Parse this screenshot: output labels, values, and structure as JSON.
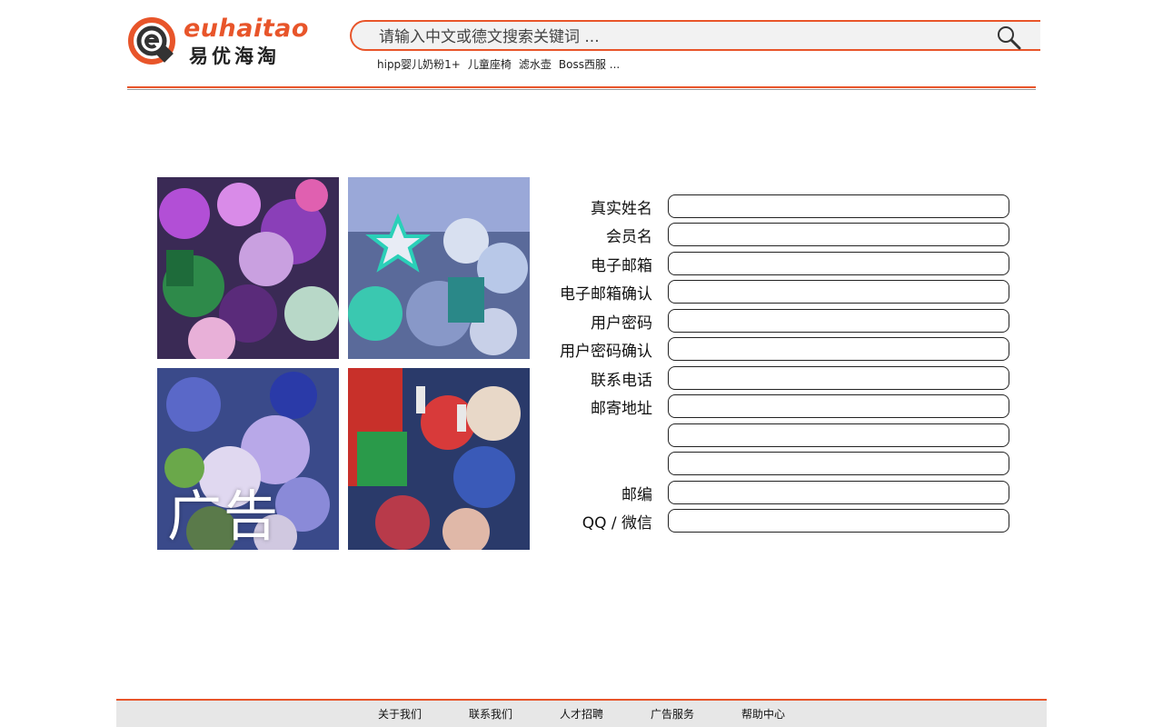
{
  "brand": {
    "name_en": "euhaitao",
    "name_cn": "易优海淘",
    "accent_color": "#e8552a"
  },
  "search": {
    "placeholder": "请输入中文或德文搜索关键词 ...",
    "icon": "search-icon",
    "hot_keywords": [
      "hipp婴儿奶粉1+",
      "儿童座椅",
      "滤水壶",
      "Boss西服 ..."
    ]
  },
  "ad": {
    "label": "广告"
  },
  "form": {
    "fields": [
      {
        "label": "真实姓名",
        "value": ""
      },
      {
        "label": "会员名",
        "value": ""
      },
      {
        "label": "电子邮箱",
        "value": ""
      },
      {
        "label": "电子邮箱确认",
        "value": ""
      },
      {
        "label": "用户密码",
        "value": ""
      },
      {
        "label": "用户密码确认",
        "value": ""
      },
      {
        "label": "联系电话",
        "value": ""
      },
      {
        "label": "邮寄地址",
        "value": ""
      },
      {
        "label": "",
        "value": ""
      },
      {
        "label": "",
        "value": ""
      },
      {
        "label": "邮编",
        "value": ""
      },
      {
        "label": "QQ / 微信",
        "value": ""
      }
    ]
  },
  "footer": {
    "links": [
      "关于我们",
      "联系我们",
      "人才招聘",
      "广告服务",
      "帮助中心"
    ]
  }
}
